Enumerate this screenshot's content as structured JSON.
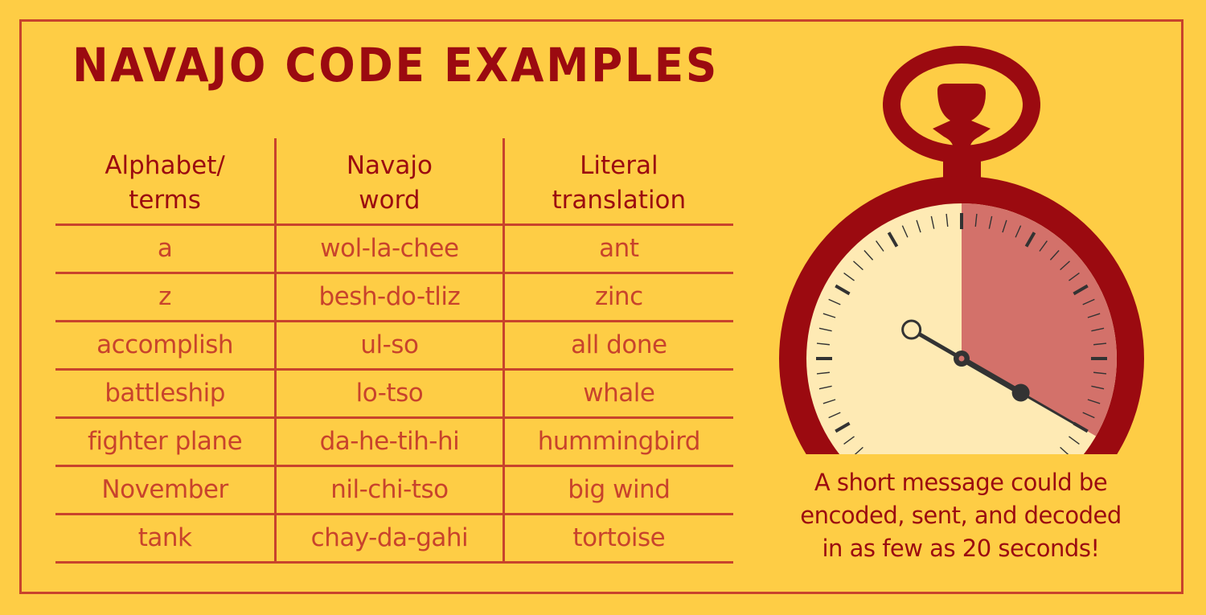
{
  "title": "NAVAJO CODE EXAMPLES",
  "colors": {
    "background": "#fecd45",
    "frame": "#c8432c",
    "title": "#9b0a10",
    "cell_text": "#c8432c",
    "watch_body": "#9b0a10",
    "watch_face": "#feeab4",
    "elapsed_wedge": "#d3716a",
    "hand": "#333333"
  },
  "table": {
    "headers": [
      [
        "Alphabet/",
        "terms"
      ],
      [
        "Navajo",
        "word"
      ],
      [
        "Literal",
        "translation"
      ]
    ],
    "rows": [
      [
        "a",
        "wol-la-chee",
        "ant"
      ],
      [
        "z",
        "besh-do-tliz",
        "zinc"
      ],
      [
        "accomplish",
        "ul-so",
        "all done"
      ],
      [
        "battleship",
        "lo-tso",
        "whale"
      ],
      [
        "fighter plane",
        "da-he-tih-hi",
        "hummingbird"
      ],
      [
        "November",
        "nil-chi-tso",
        "big wind"
      ],
      [
        "tank",
        "chay-da-gahi",
        "tortoise"
      ]
    ]
  },
  "stopwatch": {
    "icon": "stopwatch-icon",
    "scale_seconds": 60,
    "elapsed_seconds": 20
  },
  "caption": [
    "A short message could be",
    "encoded, sent, and decoded",
    "in as few as 20 seconds!"
  ]
}
